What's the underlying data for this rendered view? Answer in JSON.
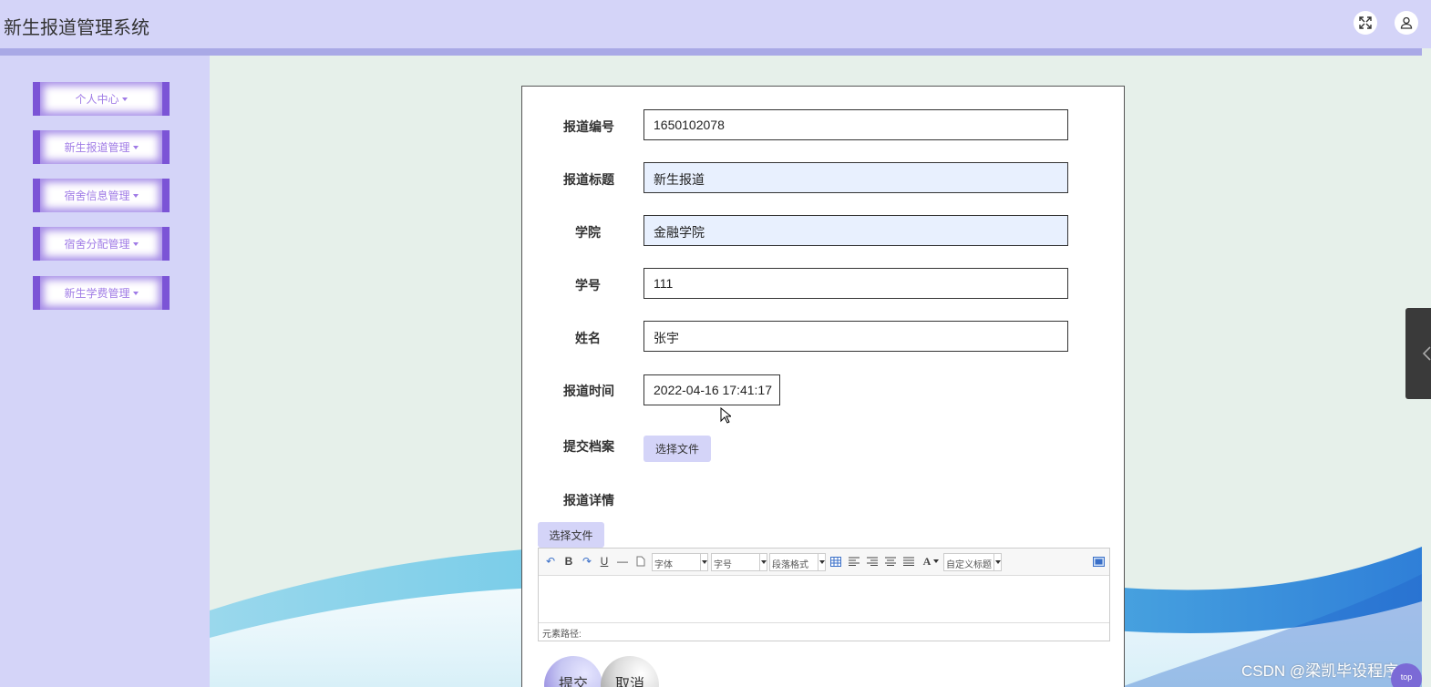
{
  "header": {
    "title": "新生报道管理系统"
  },
  "sidebar": {
    "items": [
      {
        "label": "个人中心"
      },
      {
        "label": "新生报道管理"
      },
      {
        "label": "宿舍信息管理"
      },
      {
        "label": "宿舍分配管理"
      },
      {
        "label": "新生学费管理"
      }
    ]
  },
  "form": {
    "report_no": {
      "label": "报道编号",
      "value": "1650102078"
    },
    "report_title": {
      "label": "报道标题",
      "value": "新生报道"
    },
    "college": {
      "label": "学院",
      "value": "金融学院"
    },
    "student_no": {
      "label": "学号",
      "value": "111"
    },
    "name": {
      "label": "姓名",
      "value": "张宇"
    },
    "report_time": {
      "label": "报道时间",
      "value": "2022-04-16 17:41:17"
    },
    "archive": {
      "label": "提交档案",
      "button": "选择文件"
    },
    "details": {
      "label": "报道详情",
      "button": "选择文件"
    },
    "submit_label": "提交",
    "cancel_label": "取消"
  },
  "editor": {
    "font_combo": "字体",
    "size_combo": "字号",
    "para_combo": "段落格式",
    "custom_combo": "自定义标题",
    "status_text": "元素路径:"
  },
  "watermark": "CSDN @梁凯毕设程序",
  "top_badge": "top",
  "colors": {
    "header": "#d4d4f8",
    "accent": "#7b54d6",
    "page_bg": "#e6f0ea"
  }
}
